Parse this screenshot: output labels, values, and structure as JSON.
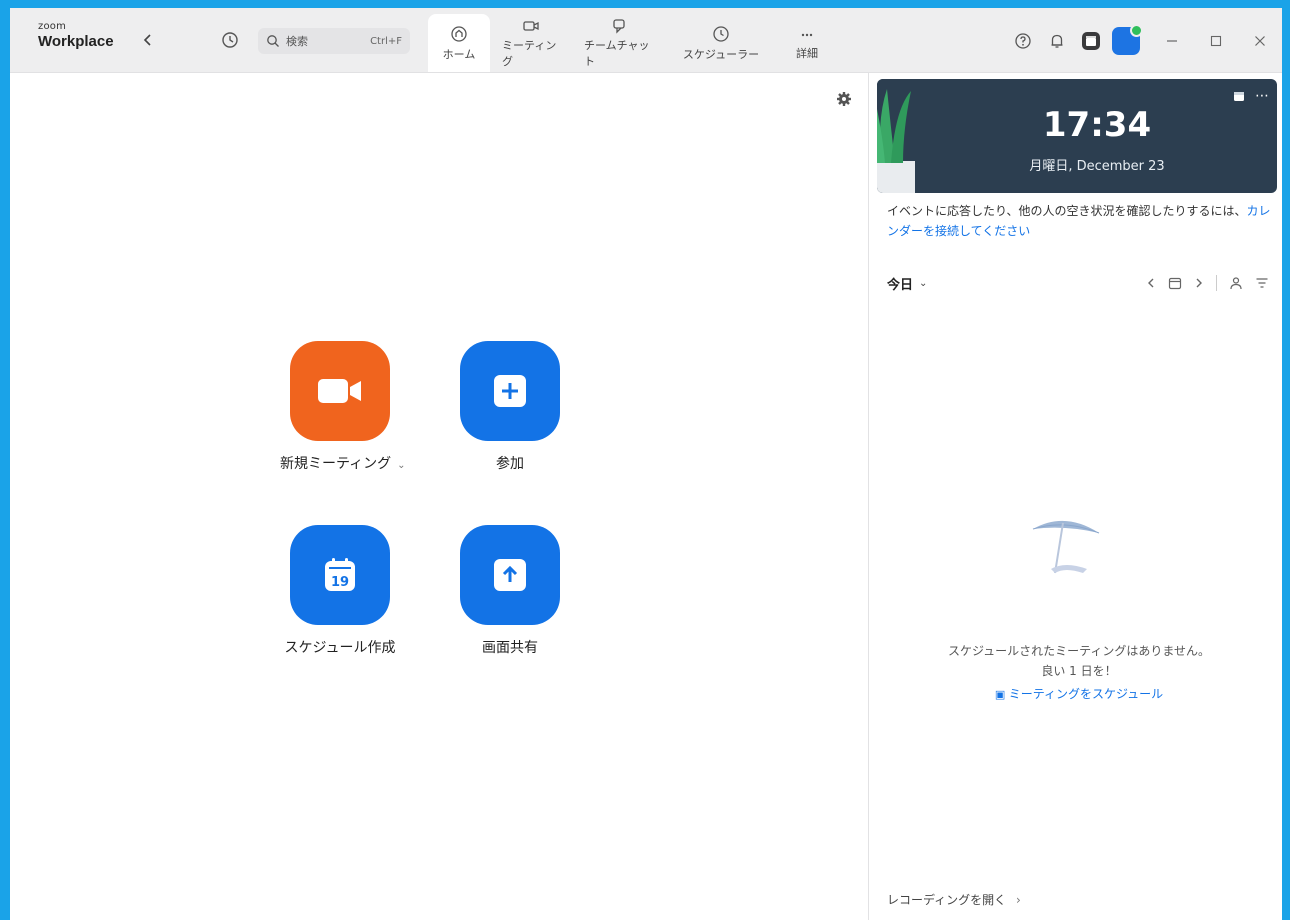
{
  "app": {
    "brand_small": "zoom",
    "brand_main": "Workplace"
  },
  "search": {
    "placeholder": "検索",
    "shortcut": "Ctrl+F"
  },
  "tabs": [
    {
      "label": "ホーム",
      "icon": "home-icon",
      "active": true
    },
    {
      "label": "ミーティング",
      "icon": "video-icon",
      "active": false
    },
    {
      "label": "チームチャット",
      "icon": "chat-icon",
      "active": false
    },
    {
      "label": "スケジューラー",
      "icon": "clock-icon",
      "active": false
    },
    {
      "label": "詳細",
      "icon": "more-icon",
      "active": false
    }
  ],
  "actions": {
    "new_meeting": "新規ミーティング",
    "join": "参加",
    "schedule": "スケジュール作成",
    "schedule_day": "19",
    "share_screen": "画面共有"
  },
  "clock": {
    "time": "17:34",
    "date": "月曜日, December 23"
  },
  "notice": {
    "text": "イベントに応答したり、他の人の空き状況を確認したりするには、",
    "link": "カレンダーを接続してください"
  },
  "calendar": {
    "today_label": "今日"
  },
  "empty": {
    "line1": "スケジュールされたミーティングはありません。",
    "line2": "良い 1 日を！",
    "link": "ミーティングをスケジュール"
  },
  "footer": {
    "recordings": "レコーディングを開く",
    "chevron": "›"
  },
  "colors": {
    "accent": "#1373e6",
    "orange": "#f0641e",
    "card_bg": "#2c3e50",
    "frame": "#1aa3e8"
  }
}
